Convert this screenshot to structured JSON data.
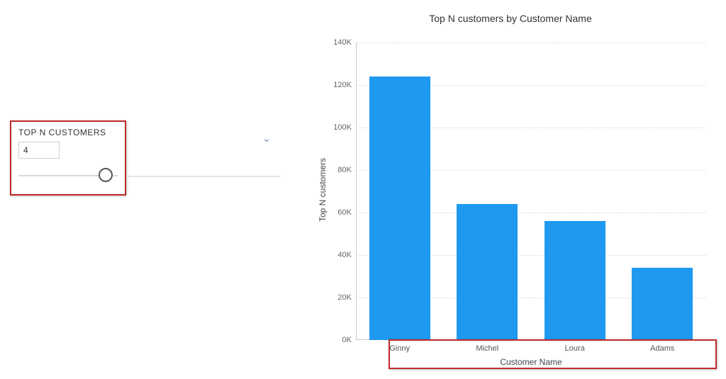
{
  "filter": {
    "title": "TOP N CUSTOMERS",
    "value": "4"
  },
  "chart_data": {
    "type": "bar",
    "title": "Top N customers by Customer Name",
    "xlabel": "Customer Name",
    "ylabel": "Top N customers",
    "categories": [
      "Ginny",
      "Michel",
      "Loura",
      "Adams"
    ],
    "values": [
      124000,
      64000,
      56000,
      34000
    ],
    "ylim": [
      0,
      140000
    ],
    "yticks": [
      0,
      20000,
      40000,
      60000,
      80000,
      100000,
      120000,
      140000
    ],
    "ytick_labels": [
      "0K",
      "20K",
      "40K",
      "60K",
      "80K",
      "100K",
      "120K",
      "140K"
    ]
  }
}
